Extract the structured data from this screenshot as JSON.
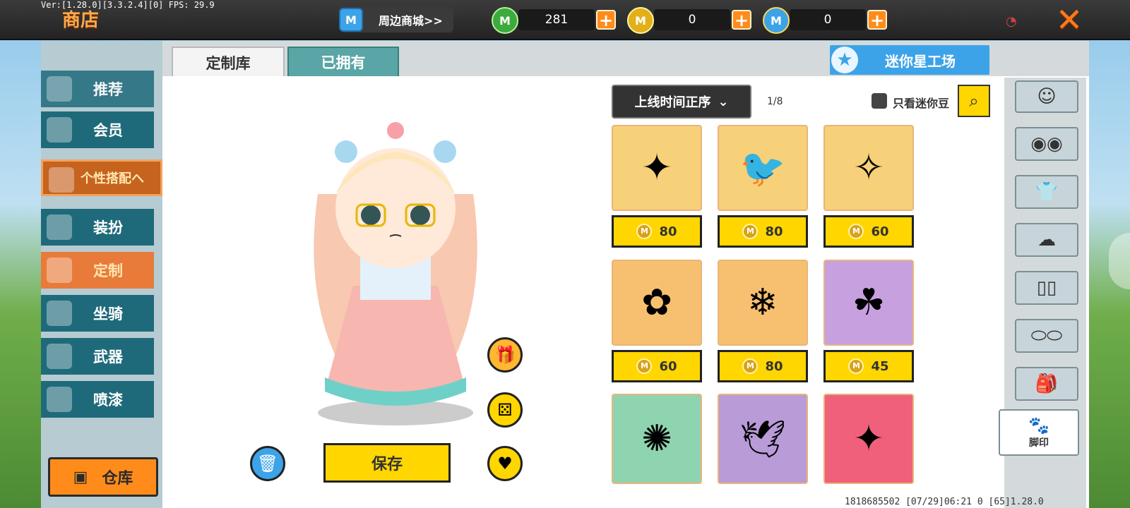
{
  "debug": {
    "version_line": "Ver:[1.28.0][3.3.2.4][0] FPS: 29.9"
  },
  "header": {
    "title": "商店",
    "shop_button": "周边商城>>",
    "shop_icon_letter": "M",
    "currencies": [
      {
        "name": "green-gem",
        "value": "281",
        "color": "#3cab3c"
      },
      {
        "name": "gold-coin",
        "value": "0",
        "color": "#e3b01a"
      },
      {
        "name": "blue-coin",
        "value": "0",
        "color": "#3da3e8"
      }
    ],
    "plus_label": "+",
    "close_label": "✕"
  },
  "sidebar": {
    "items": [
      {
        "label": "推荐"
      },
      {
        "label": "会员"
      },
      {
        "label": "个性搭配へ"
      },
      {
        "label": "装扮"
      },
      {
        "label": "定制"
      },
      {
        "label": "坐骑"
      },
      {
        "label": "武器"
      },
      {
        "label": "喷漆"
      }
    ],
    "warehouse": "仓库"
  },
  "tabs": [
    {
      "label": "定制库"
    },
    {
      "label": "已拥有"
    }
  ],
  "workshop": "迷你星工场",
  "filters": {
    "sort": "上线时间正序",
    "page": "1/8",
    "checkbox_label": "只看迷你豆"
  },
  "items": [
    {
      "price": "80",
      "bg": "#f7d07a",
      "art": "✦"
    },
    {
      "price": "80",
      "bg": "#f7d07a",
      "art": "🐦"
    },
    {
      "price": "60",
      "bg": "#f7d07a",
      "art": "✧"
    },
    {
      "price": "60",
      "bg": "#f7c070",
      "art": "✿"
    },
    {
      "price": "80",
      "bg": "#f7c070",
      "art": "❄"
    },
    {
      "price": "45",
      "bg": "#c7a0e0",
      "art": "☘"
    },
    {
      "price": "",
      "bg": "#8fd4b0",
      "art": "✺"
    },
    {
      "price": "",
      "bg": "#b99bd8",
      "art": "🕊"
    },
    {
      "price": "",
      "bg": "#f0607a",
      "art": "✦"
    }
  ],
  "categories": [
    "face-icon",
    "mask-icon",
    "shirt-icon",
    "hair-icon",
    "pants-icon",
    "shoes-icon",
    "backpack-icon"
  ],
  "footprint_label": "脚印",
  "editor": {
    "save": "保存"
  },
  "footer": "1818685502   [07/29]06:21 0  [65]1.28.0"
}
